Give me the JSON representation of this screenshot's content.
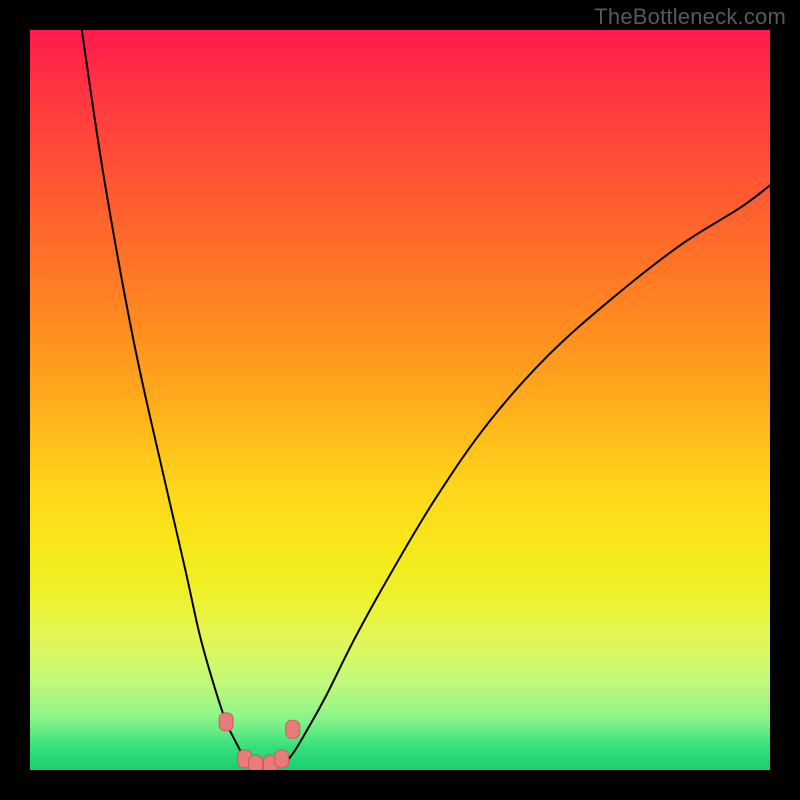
{
  "watermark": "TheBottleneck.com",
  "colors": {
    "frame": "#000000",
    "curve": "#000000",
    "marker_fill": "#e77c7a",
    "marker_stroke": "#cf5a58",
    "gradient_stops": [
      "#ff1a4d",
      "#ff6a2a",
      "#ffd61a",
      "#eef12a",
      "#8af58a",
      "#1bce73"
    ]
  },
  "chart_data": {
    "type": "line",
    "title": "",
    "xlabel": "",
    "ylabel": "",
    "xlim": [
      0,
      100
    ],
    "ylim": [
      0,
      100
    ],
    "series": [
      {
        "name": "left-curve",
        "x": [
          7,
          10,
          14,
          18,
          21,
          23,
          25,
          26.5,
          27.8,
          29,
          30
        ],
        "y": [
          100,
          80,
          58,
          40,
          27,
          18,
          11,
          6.5,
          3.8,
          1.6,
          0.5
        ]
      },
      {
        "name": "right-curve",
        "x": [
          34,
          35.5,
          37.5,
          40,
          44,
          49,
          55,
          62,
          70,
          79,
          88,
          96,
          100
        ],
        "y": [
          0.5,
          2.2,
          5.5,
          10,
          18,
          27,
          37,
          47,
          56,
          64,
          71,
          76,
          79
        ]
      }
    ],
    "markers": {
      "name": "highlight-points",
      "points": [
        {
          "x": 26.5,
          "y": 6.5
        },
        {
          "x": 29.0,
          "y": 1.5
        },
        {
          "x": 30.5,
          "y": 0.8
        },
        {
          "x": 32.5,
          "y": 0.8
        },
        {
          "x": 34.0,
          "y": 1.5
        },
        {
          "x": 35.5,
          "y": 5.5
        }
      ]
    }
  }
}
